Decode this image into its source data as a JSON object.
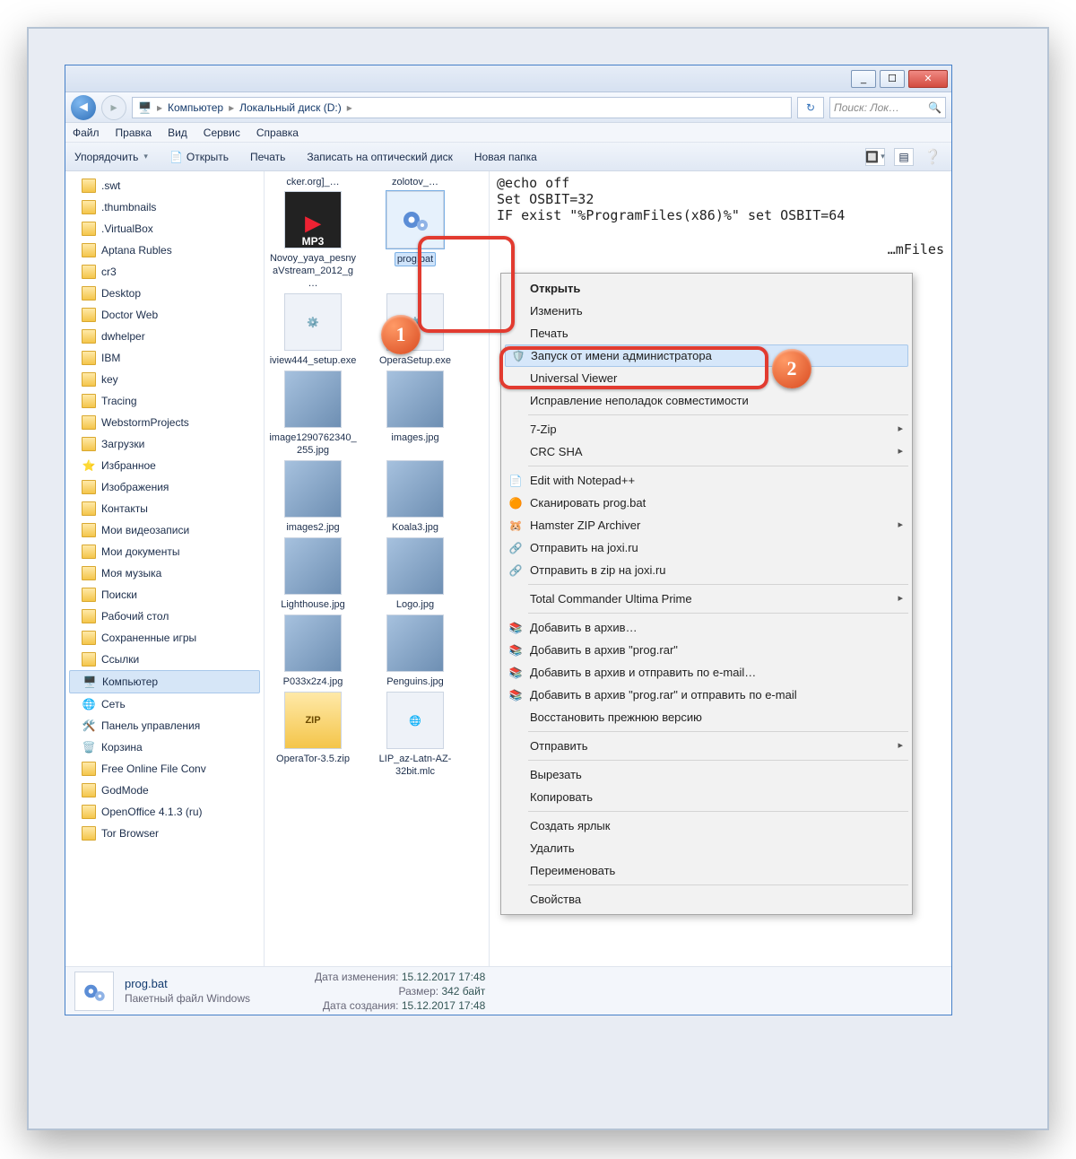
{
  "titlebar": {
    "min": "_",
    "max": "☐",
    "close": "✕"
  },
  "breadcrumb": {
    "icon": "💻",
    "loc1": "Компьютер",
    "loc2": "Локальный диск (D:)"
  },
  "search": {
    "placeholder": "Поиск: Лок…"
  },
  "menu": {
    "file": "Файл",
    "edit": "Правка",
    "view": "Вид",
    "service": "Сервис",
    "help": "Справка"
  },
  "toolbar": {
    "organize": "Упорядочить",
    "open": "Открыть",
    "print": "Печать",
    "burn": "Записать на оптический диск",
    "newfolder": "Новая папка"
  },
  "tree": {
    "items": [
      {
        "label": ".swt",
        "ic": "folder"
      },
      {
        "label": ".thumbnails",
        "ic": "folder"
      },
      {
        "label": ".VirtualBox",
        "ic": "folder"
      },
      {
        "label": "Aptana Rubles",
        "ic": "folder"
      },
      {
        "label": "cr3",
        "ic": "folder"
      },
      {
        "label": "Desktop",
        "ic": "folder"
      },
      {
        "label": "Doctor Web",
        "ic": "folder"
      },
      {
        "label": "dwhelper",
        "ic": "folder"
      },
      {
        "label": "IBM",
        "ic": "folder"
      },
      {
        "label": "key",
        "ic": "folder"
      },
      {
        "label": "Tracing",
        "ic": "folder"
      },
      {
        "label": "WebstormProjects",
        "ic": "folder"
      },
      {
        "label": "Загрузки",
        "ic": "folder-dl"
      },
      {
        "label": "Избранное",
        "ic": "fav"
      },
      {
        "label": "Изображения",
        "ic": "folder"
      },
      {
        "label": "Контакты",
        "ic": "folder"
      },
      {
        "label": "Мои видеозаписи",
        "ic": "folder"
      },
      {
        "label": "Мои документы",
        "ic": "folder"
      },
      {
        "label": "Моя музыка",
        "ic": "folder"
      },
      {
        "label": "Поиски",
        "ic": "folder"
      },
      {
        "label": "Рабочий стол",
        "ic": "folder"
      },
      {
        "label": "Сохраненные игры",
        "ic": "folder"
      },
      {
        "label": "Ссылки",
        "ic": "folder"
      },
      {
        "label": "Компьютер",
        "ic": "pc",
        "selected": true
      },
      {
        "label": "Сеть",
        "ic": "net"
      },
      {
        "label": "Панель управления",
        "ic": "cpl"
      },
      {
        "label": "Корзина",
        "ic": "bin"
      },
      {
        "label": "Free Online File Conv",
        "ic": "folder"
      },
      {
        "label": "GodMode",
        "ic": "folder"
      },
      {
        "label": "OpenOffice 4.1.3 (ru)",
        "ic": "folder"
      },
      {
        "label": "Tor Browser",
        "ic": "folder"
      }
    ]
  },
  "files": {
    "col0top": "cker.org]_…",
    "col1top": "zolotov_…",
    "list": [
      {
        "name": "Novoy_yaya_pesnyaVstream_2012_g…",
        "type": "mp3"
      },
      {
        "name": "prog.bat",
        "type": "bat",
        "selected": true
      },
      {
        "name": "iview444_setup.exe",
        "type": "exe"
      },
      {
        "name": "OperaSetup.exe",
        "type": "exe"
      },
      {
        "name": "image1290762340_255.jpg",
        "type": "img"
      },
      {
        "name": "images.jpg",
        "type": "img"
      },
      {
        "name": "images2.jpg",
        "type": "img"
      },
      {
        "name": "Koala3.jpg",
        "type": "img"
      },
      {
        "name": "Lighthouse.jpg",
        "type": "img"
      },
      {
        "name": "Logo.jpg",
        "type": "img"
      },
      {
        "name": "P033x2z4.jpg",
        "type": "img"
      },
      {
        "name": "Penguins.jpg",
        "type": "img"
      },
      {
        "name": "OperaTor-3.5.zip",
        "type": "zip"
      },
      {
        "name": "LIP_az-Latn-AZ-32bit.mlc",
        "type": "mlc"
      }
    ]
  },
  "preview": {
    "l1": "@echo off",
    "l2": "Set OSBIT=32",
    "l3": "IF exist \"%ProgramFiles(x86)%\" set OSBIT=64",
    "l4": "…mFiles"
  },
  "context_menu": {
    "items": [
      {
        "label": "Открыть",
        "bold": true
      },
      {
        "label": "Изменить"
      },
      {
        "label": "Печать"
      },
      {
        "label": "Запуск от имени администратора",
        "icon": "shield",
        "highlight": true
      },
      {
        "label": "Universal Viewer"
      },
      {
        "label": "Исправление неполадок совместимости"
      },
      {
        "sep": true
      },
      {
        "label": "7-Zip",
        "sub": true
      },
      {
        "label": "CRC SHA",
        "sub": true
      },
      {
        "sep": true
      },
      {
        "label": "Edit with Notepad++",
        "icon": "npp"
      },
      {
        "label": "Сканировать prog.bat",
        "icon": "avast"
      },
      {
        "label": "Hamster ZIP Archiver",
        "icon": "hamster",
        "sub": true
      },
      {
        "label": "Отправить на joxi.ru",
        "icon": "joxi"
      },
      {
        "label": "Отправить в zip на joxi.ru",
        "icon": "joxi"
      },
      {
        "sep": true
      },
      {
        "label": "Total Commander Ultima Prime",
        "sub": true
      },
      {
        "sep": true
      },
      {
        "label": "Добавить в архив…",
        "icon": "rar"
      },
      {
        "label": "Добавить в архив \"prog.rar\"",
        "icon": "rar"
      },
      {
        "label": "Добавить в архив и отправить по e-mail…",
        "icon": "rar"
      },
      {
        "label": "Добавить в архив \"prog.rar\" и отправить по e-mail",
        "icon": "rar"
      },
      {
        "label": "Восстановить прежнюю версию"
      },
      {
        "sep": true
      },
      {
        "label": "Отправить",
        "sub": true
      },
      {
        "sep": true
      },
      {
        "label": "Вырезать"
      },
      {
        "label": "Копировать"
      },
      {
        "sep": true
      },
      {
        "label": "Создать ярлык"
      },
      {
        "label": "Удалить"
      },
      {
        "label": "Переименовать"
      },
      {
        "sep": true
      },
      {
        "label": "Свойства"
      }
    ]
  },
  "callouts": {
    "one": "1",
    "two": "2"
  },
  "status": {
    "name": "prog.bat",
    "type": "Пакетный файл Windows",
    "k_mod": "Дата изменения:",
    "v_mod": "15.12.2017 17:48",
    "k_size": "Размер:",
    "v_size": "342 байт",
    "k_created": "Дата создания:",
    "v_created": "15.12.2017 17:48"
  }
}
